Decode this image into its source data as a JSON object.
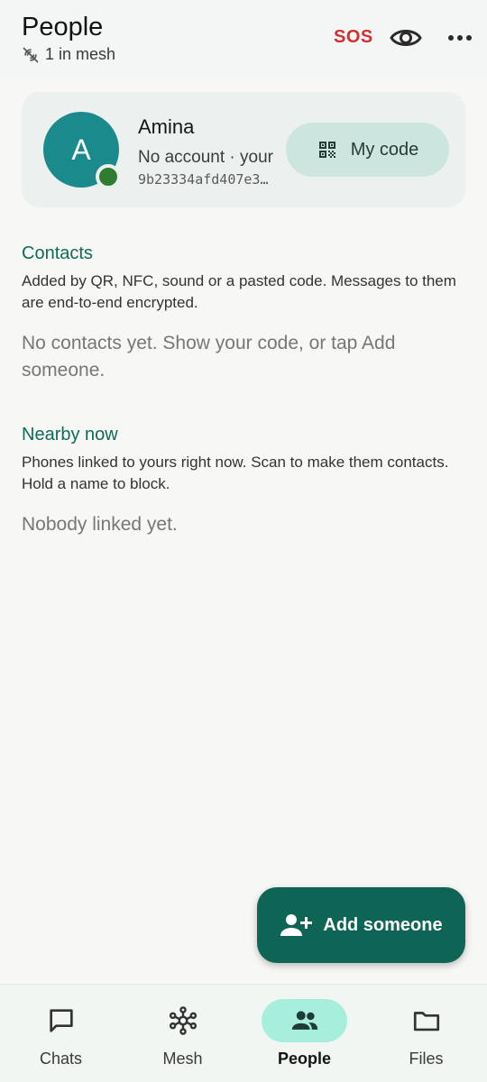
{
  "header": {
    "title": "People",
    "mesh_status": "1 in mesh",
    "sos_label": "SOS"
  },
  "profile": {
    "avatar_letter": "A",
    "name": "Amina",
    "status": "No account · your",
    "id": "9b23334afd407e3…",
    "my_code_label": "My code"
  },
  "contacts": {
    "title": "Contacts",
    "description": "Added by QR, NFC, sound or a pasted code. Messages to them are end-to-end encrypted.",
    "empty": "No contacts yet. Show your code, or tap Add someone."
  },
  "nearby": {
    "title": "Nearby now",
    "description": "Phones linked to yours right now. Scan to make them contacts. Hold a name to block.",
    "empty": "Nobody linked yet."
  },
  "fab": {
    "label": "Add someone"
  },
  "nav": {
    "items": [
      {
        "label": "Chats",
        "icon": "chat-icon",
        "active": false
      },
      {
        "label": "Mesh",
        "icon": "mesh-icon",
        "active": false
      },
      {
        "label": "People",
        "icon": "people-icon",
        "active": true
      },
      {
        "label": "Files",
        "icon": "folder-icon",
        "active": false
      }
    ]
  },
  "colors": {
    "accent": "#0f6555",
    "section_title": "#0f6a58",
    "sos": "#d32f2f",
    "avatar": "#1b8a8c",
    "presence": "#2e7d32",
    "nav_active": "#a7eedd"
  }
}
